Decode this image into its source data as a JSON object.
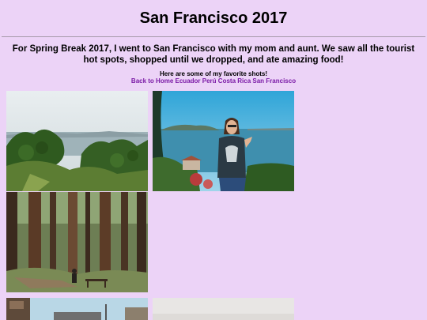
{
  "page": {
    "title": "San Francisco 2017",
    "intro": "For Spring Break 2017, I went to San Francisco with my mom and aunt. We saw all the tourist hot spots, shopped until we dropped, and ate amazing food!",
    "subheading": "Here are some of my favorite shots!"
  },
  "nav": {
    "links": [
      "Back to Home",
      "Ecuador",
      "Perú",
      "Costa Rica",
      "San Francisco"
    ]
  },
  "colors": {
    "background": "#ecd3f7",
    "link": "#7a1aa6"
  },
  "photos": [
    "bay-view-with-shrubs-photo",
    "person-at-overlook-photo",
    "redwood-forest-photo",
    "building-photo",
    "light-gray-photo"
  ]
}
